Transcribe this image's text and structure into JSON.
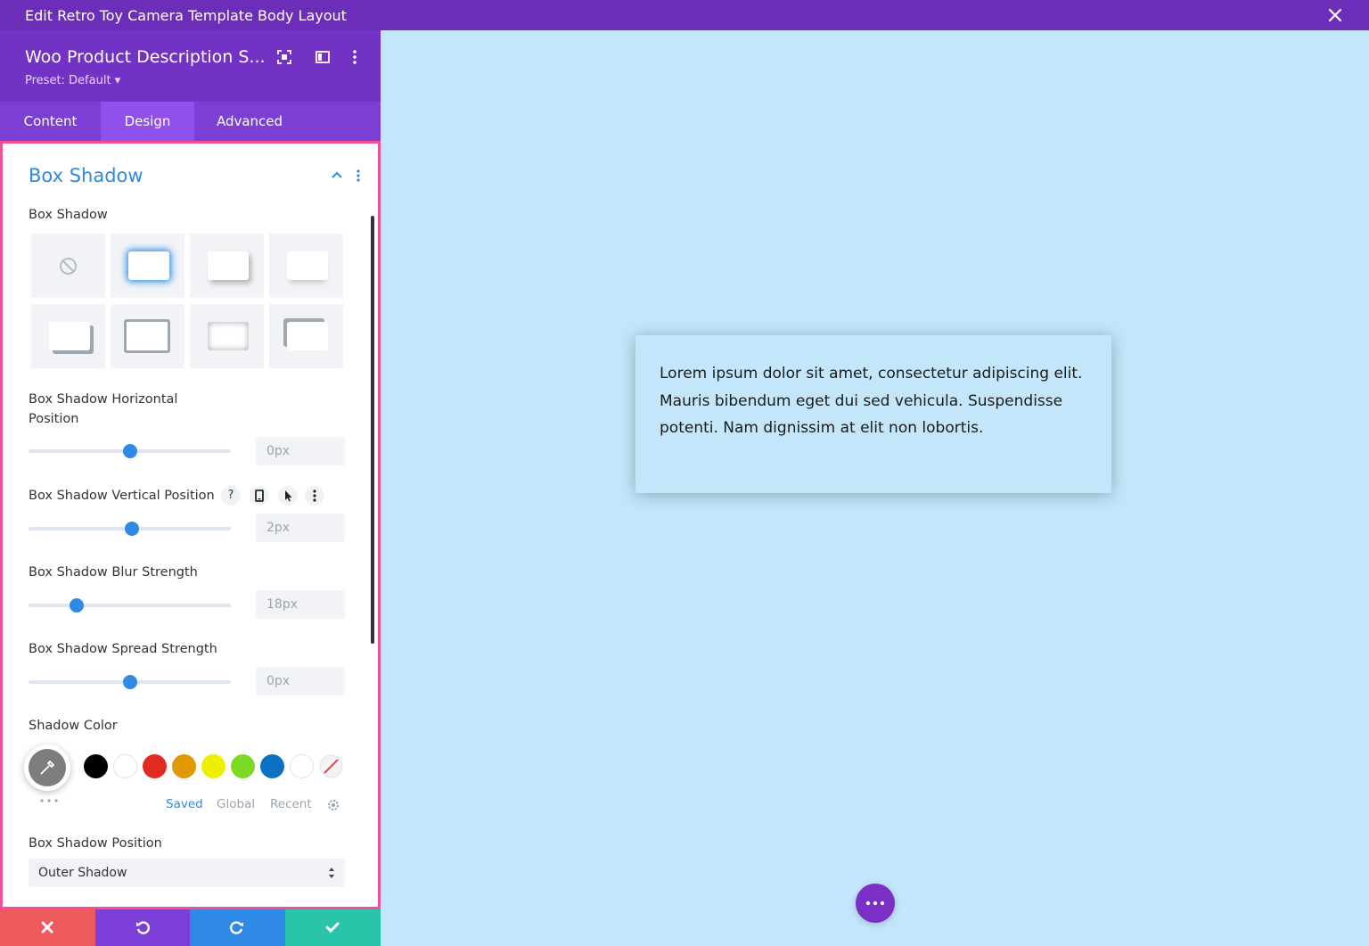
{
  "window": {
    "title": "Edit Retro Toy Camera Template Body Layout"
  },
  "module": {
    "title": "Woo Product Description S...",
    "preset": "Preset: Default ▾"
  },
  "tabs": [
    {
      "label": "Content",
      "active": false
    },
    {
      "label": "Design",
      "active": true
    },
    {
      "label": "Advanced",
      "active": false
    }
  ],
  "section": {
    "title": "Box Shadow"
  },
  "box_shadow": {
    "label": "Box Shadow",
    "presets": [
      "none",
      "glow-selected",
      "bottom-right",
      "bottom",
      "offset-bottom-right",
      "border-thick",
      "inset",
      "top-left-border"
    ]
  },
  "horizontal": {
    "label": "Box Shadow Horizontal Position",
    "value": "0px",
    "level": 0.5
  },
  "vertical": {
    "label": "Box Shadow Vertical Position",
    "value": "2px",
    "level": 0.51
  },
  "blur": {
    "label": "Box Shadow Blur Strength",
    "value": "18px",
    "level": 0.24
  },
  "spread": {
    "label": "Box Shadow Spread Strength",
    "value": "0px",
    "level": 0.5
  },
  "shadow_color": {
    "label": "Shadow Color",
    "swatches": [
      "#000000",
      "#ffffff",
      "#e02b20",
      "#e09900",
      "#edf000",
      "#7cda24",
      "#0c71c3",
      "#ffffff",
      "transparent"
    ],
    "tabs": [
      "Saved",
      "Global",
      "Recent"
    ],
    "active_tab": "Saved"
  },
  "position": {
    "label": "Box Shadow Position",
    "value": "Outer Shadow"
  },
  "preview_text": "Lorem ipsum dolor sit amet, consectetur adipiscing elit. Mauris bibendum eget dui sed vehicula. Suspendisse potenti. Nam dignissim at elit non lobortis.",
  "colors": {
    "accent": "#2e8ae5",
    "header": "#6c2eb9",
    "canvas": "#c4e6fb",
    "cancel": "#ef5a5f",
    "undo": "#7c3ed9",
    "redo": "#2e8ae5",
    "save": "#29c4a9"
  }
}
